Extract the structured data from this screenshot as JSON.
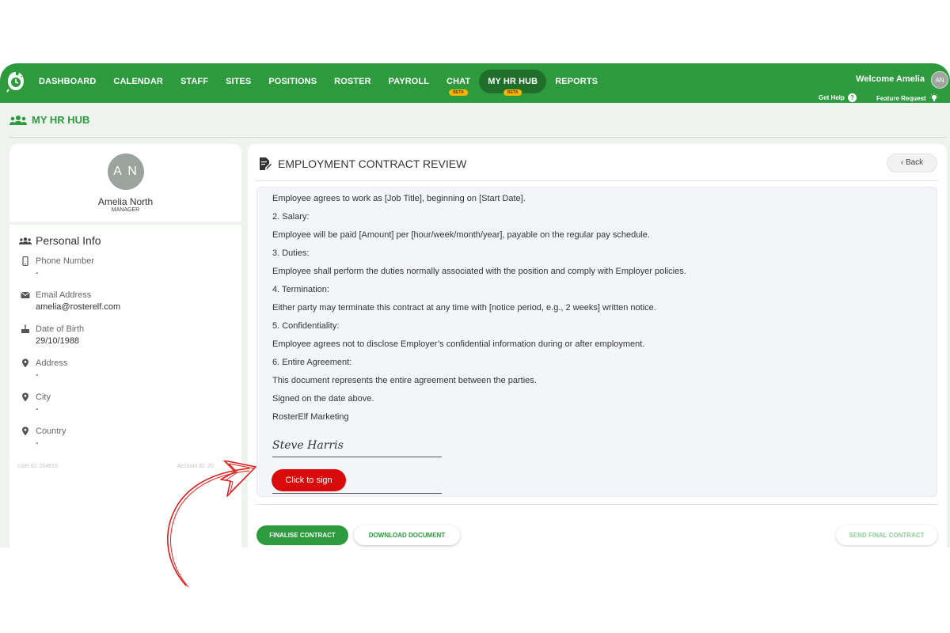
{
  "nav": {
    "items": [
      {
        "label": "DASHBOARD"
      },
      {
        "label": "CALENDAR"
      },
      {
        "label": "STAFF"
      },
      {
        "label": "SITES"
      },
      {
        "label": "POSITIONS"
      },
      {
        "label": "ROSTER"
      },
      {
        "label": "PAYROLL"
      },
      {
        "label": "CHAT",
        "badge": "BETA"
      },
      {
        "label": "MY HR HUB",
        "badge": "BETA",
        "active": true
      },
      {
        "label": "REPORTS"
      }
    ],
    "welcome": "Welcome Amelia",
    "avatar_initials": "AN",
    "get_help": "Get Help",
    "feature_request": "Feature Request",
    "brand_color": "#2e9a3e"
  },
  "page": {
    "title": "MY HR HUB"
  },
  "profile": {
    "initials": "A N",
    "name": "Amelia North",
    "role": "MANAGER",
    "section_title": "Personal Info",
    "fields": [
      {
        "label": "Phone Number",
        "value": "-",
        "icon": "phone-icon"
      },
      {
        "label": "Email Address",
        "value": "amelia@rosterelf.com",
        "icon": "mail-icon"
      },
      {
        "label": "Date of Birth",
        "value": "29/10/1988",
        "icon": "cake-icon"
      },
      {
        "label": "Address",
        "value": "-",
        "icon": "location-pin-icon"
      },
      {
        "label": "City",
        "value": "-",
        "icon": "location-pin-icon"
      },
      {
        "label": "Country",
        "value": "-",
        "icon": "location-pin-icon"
      }
    ],
    "user_id": "User ID: 204619",
    "account_id": "Account ID: 20"
  },
  "contract": {
    "title": "EMPLOYMENT CONTRACT REVIEW",
    "back_label": "Back",
    "lines": [
      "Employee agrees to work as [Job Title], beginning on [Start Date].",
      "2. Salary:",
      "Employee will be paid [Amount] per [hour/week/month/year], payable on the regular pay schedule.",
      "3. Duties:",
      "Employee shall perform the duties normally associated with the position and comply with Employer policies.",
      "4. Termination:",
      "Either party may terminate this contract at any time with [notice period, e.g., 2 weeks] written notice.",
      "5. Confidentiality:",
      "Employee agrees not to disclose Employer’s confidential information during or after employment.",
      "6. Entire Agreement:",
      "This document represents the entire agreement between the parties.",
      "Signed on the date above.",
      "RosterElf Marketing"
    ],
    "signature": "Steve Harris",
    "sign_button": "Click to sign",
    "sign_button_color": "#d90a0a"
  },
  "actions": {
    "finalise": "FINALISE CONTRACT",
    "download": "DOWNLOAD DOCUMENT",
    "send_final": "SEND FINAL CONTRACT"
  }
}
